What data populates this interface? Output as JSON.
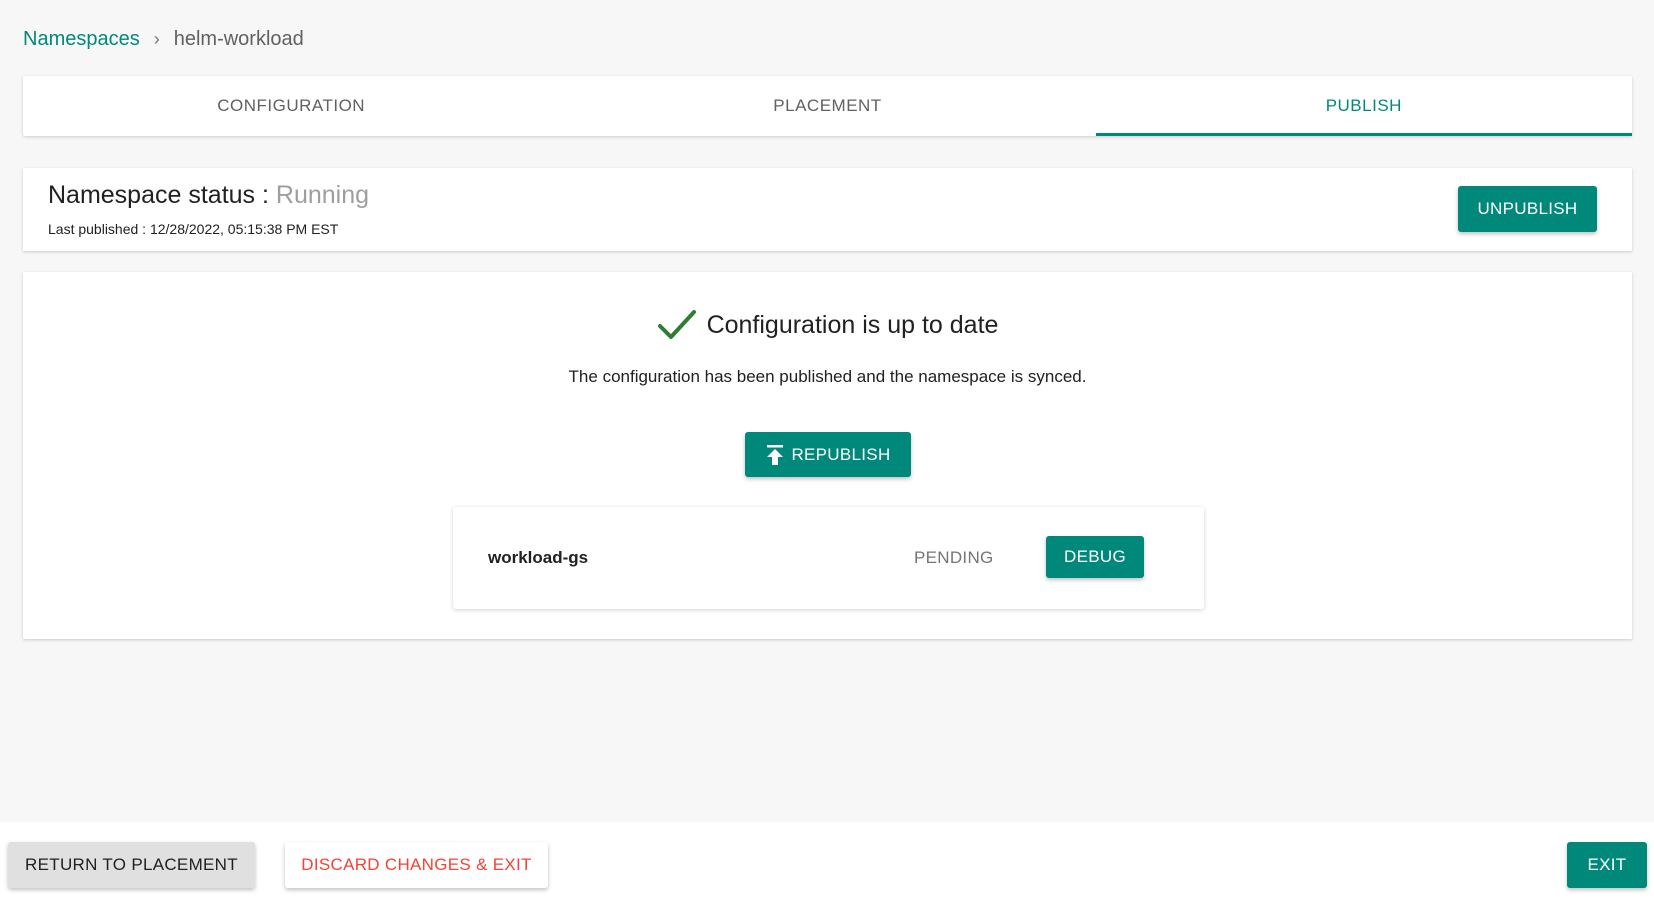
{
  "breadcrumb": {
    "parent": "Namespaces",
    "separator": "›",
    "current": "helm-workload"
  },
  "tabs": [
    {
      "label": "CONFIGURATION",
      "active": false
    },
    {
      "label": "PLACEMENT",
      "active": false
    },
    {
      "label": "PUBLISH",
      "active": true
    }
  ],
  "status": {
    "label": "Namespace status : ",
    "value": "Running",
    "last_published": "Last published : 12/28/2022, 05:15:38 PM EST",
    "unpublish_label": "UNPUBLISH"
  },
  "publish": {
    "headline": "Configuration is up to date",
    "message": "The configuration has been published and the namespace is synced.",
    "republish_label": "REPUBLISH"
  },
  "clusters": [
    {
      "name": "workload-gs",
      "status": "PENDING",
      "action_label": "DEBUG"
    }
  ],
  "footer": {
    "return_label": "RETURN TO PLACEMENT",
    "discard_label": "DISCARD CHANGES & EXIT",
    "exit_label": "EXIT"
  },
  "colors": {
    "accent": "#00897b",
    "success": "#2e7d32",
    "danger": "#f44336"
  },
  "icons": {
    "check": "check-icon",
    "upload": "upload-icon"
  }
}
